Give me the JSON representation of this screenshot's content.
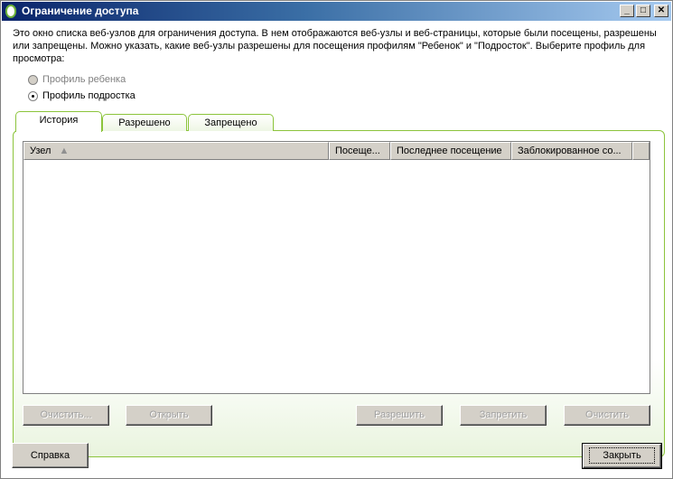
{
  "window": {
    "title": "Ограничение доступа"
  },
  "description": "Это окно списка веб-узлов для ограничения доступа. В нем отображаются веб-узлы и веб-страницы, которые были посещены, разрешены или запрещены. Можно указать, какие веб-узлы разрешены для посещения профилям \"Ребенок\" и \"Подросток\". Выберите профиль для просмотра:",
  "profiles": [
    {
      "label": "Профиль ребенка",
      "checked": false,
      "disabled": true
    },
    {
      "label": "Профиль подростка",
      "checked": true,
      "disabled": false
    }
  ],
  "tabs": [
    "История",
    "Разрешено",
    "Запрещено"
  ],
  "columns": [
    "Узел",
    "Посеще...",
    "Последнее посещение",
    "Заблокированное со..."
  ],
  "list_buttons": [
    "Очистить...",
    "Открыть",
    "Разрешить",
    "Запретить",
    "Очистить"
  ],
  "help_label": "Справка",
  "close_label": "Закрыть",
  "colors": {
    "accent": "#8cc43c",
    "title": "#0a246a"
  }
}
